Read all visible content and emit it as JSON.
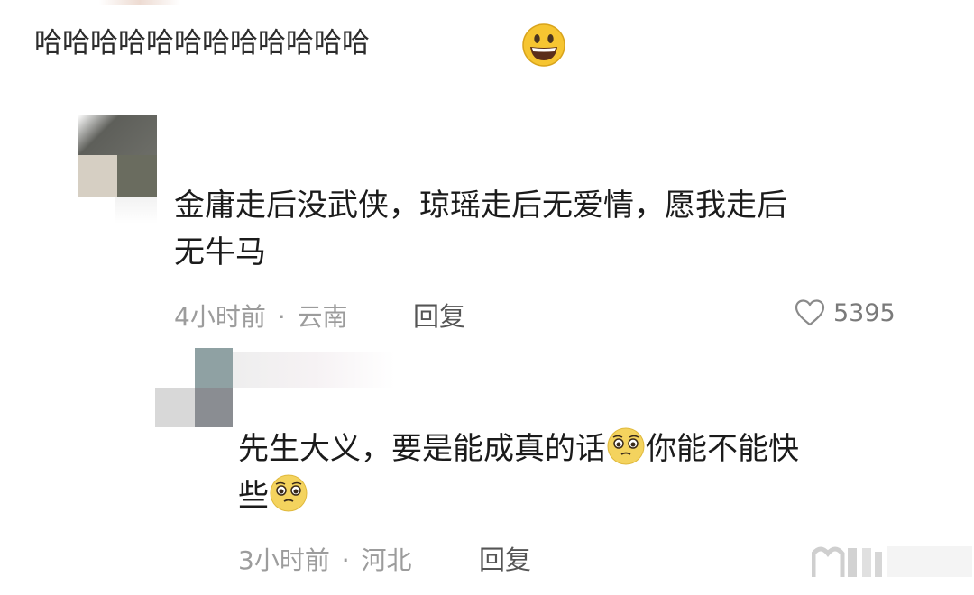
{
  "top_comment": {
    "text": "哈哈哈哈哈哈哈哈哈哈哈哈",
    "emoji": "grinning-face-emoji"
  },
  "comment_1": {
    "text_line1": "金庸走后没武侠，琼瑶走后无爱情，愿我走后",
    "text_line2": "无牛马",
    "time": "4小时前",
    "separator": "·",
    "location": "云南",
    "reply_label": "回复",
    "like_count": "5395"
  },
  "comment_2": {
    "text_line1_a": "先生大义，要是能成真的话",
    "text_line1_b": "你能不能快",
    "text_line2": "些",
    "emoji": "pleading-face-emoji",
    "time": "3小时前",
    "separator": "·",
    "location": "河北",
    "reply_label": "回复"
  },
  "colors": {
    "text": "#1b1b1b",
    "meta": "#9c9c9c",
    "emoji_yellow": "#f6c531"
  }
}
